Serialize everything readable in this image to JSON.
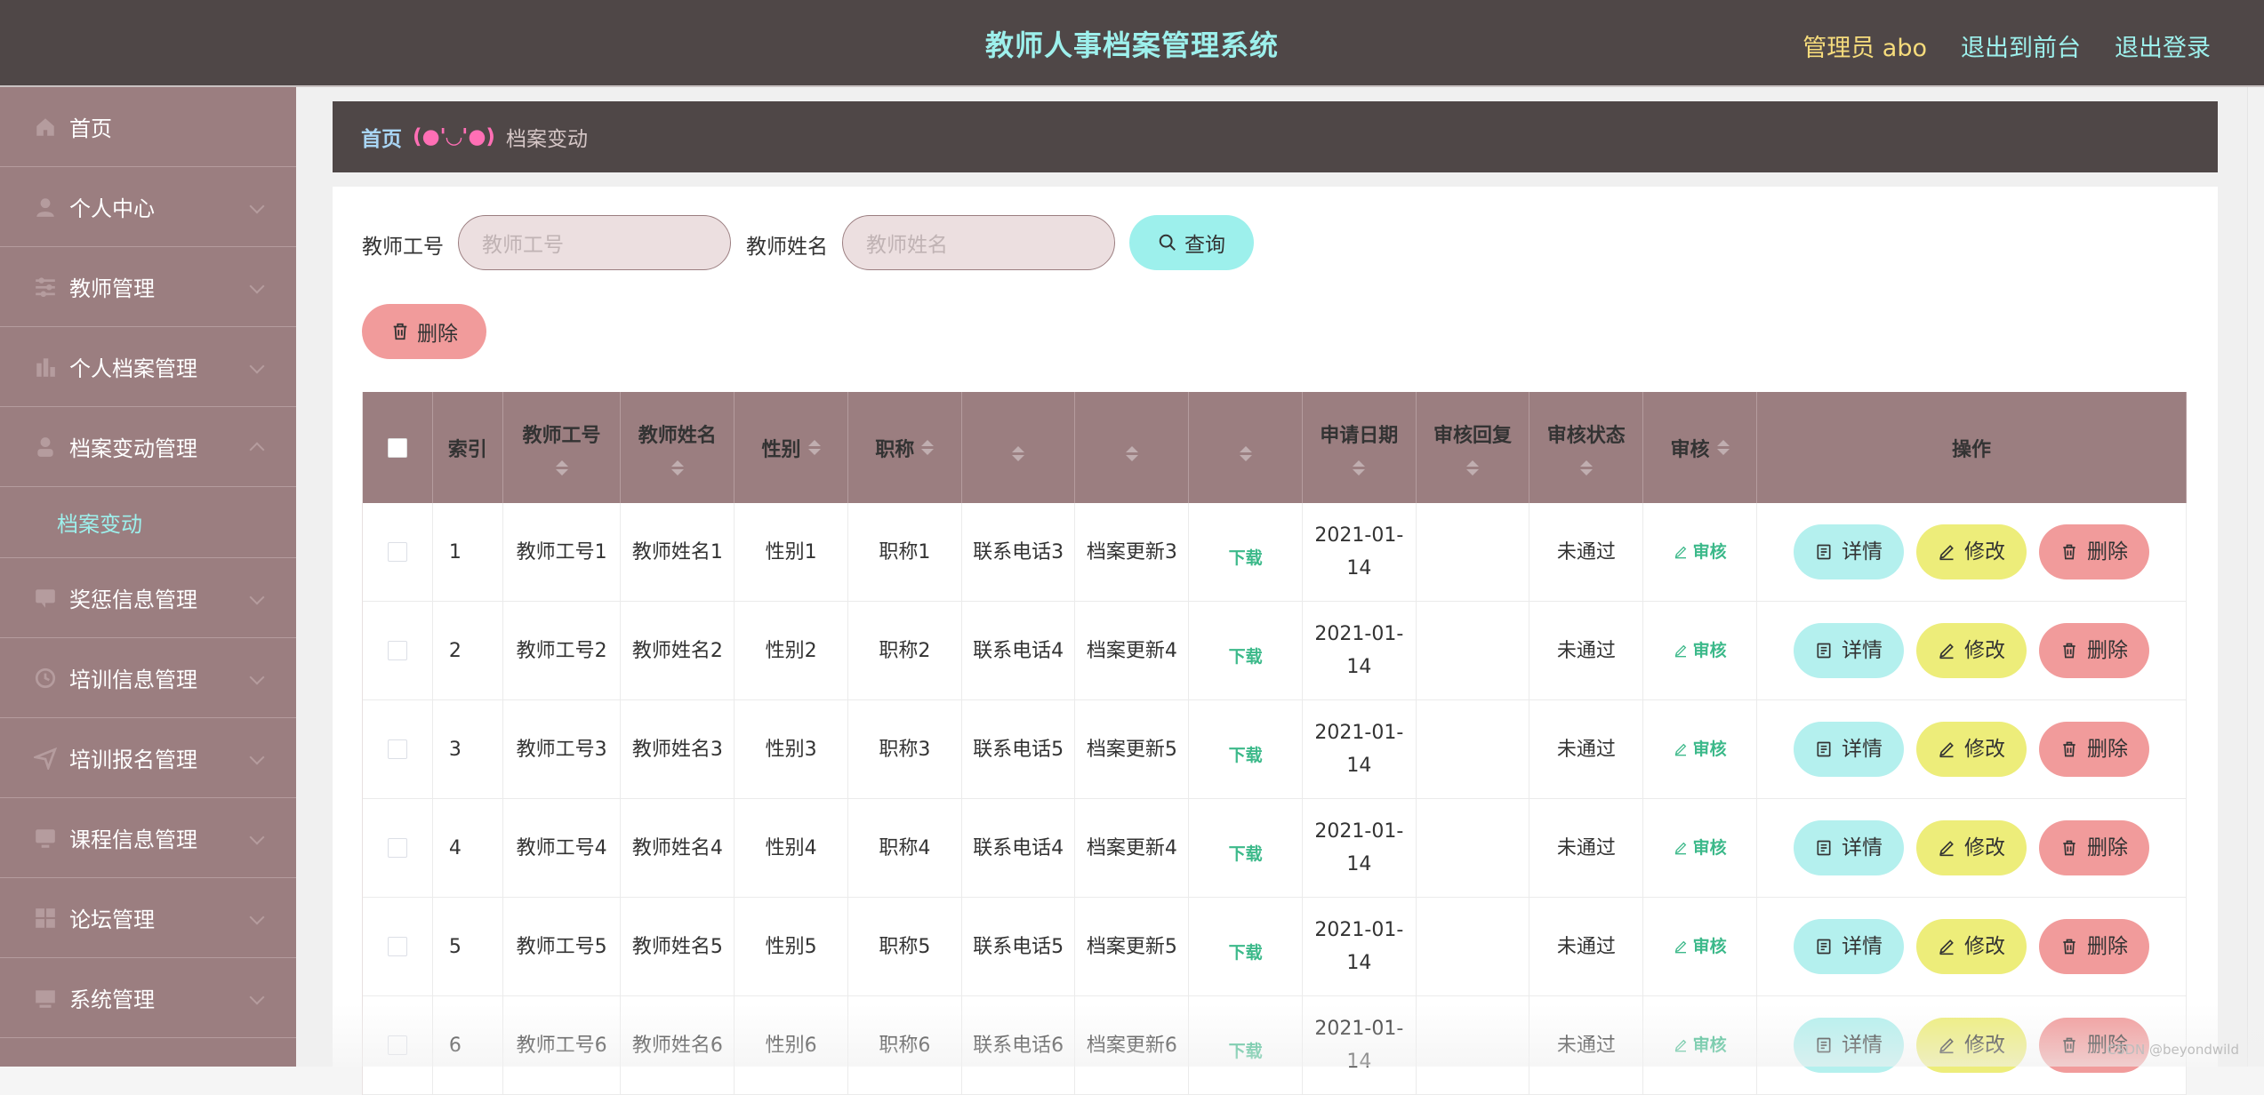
{
  "header": {
    "title": "教师人事档案管理系统",
    "user": "管理员 abo",
    "to_front": "退出到前台",
    "logout": "退出登录"
  },
  "sidebar": {
    "items": [
      {
        "label": "首页",
        "icon": "home-icon"
      },
      {
        "label": "个人中心",
        "icon": "user-icon"
      },
      {
        "label": "教师管理",
        "icon": "sliders-icon"
      },
      {
        "label": "个人档案管理",
        "icon": "bar-chart-icon"
      },
      {
        "label": "档案变动管理",
        "icon": "person-icon",
        "expanded": true
      },
      {
        "label": "奖惩信息管理",
        "icon": "chat-icon"
      },
      {
        "label": "培训信息管理",
        "icon": "clock-icon"
      },
      {
        "label": "培训报名管理",
        "icon": "send-icon"
      },
      {
        "label": "课程信息管理",
        "icon": "monitor-icon"
      },
      {
        "label": "论坛管理",
        "icon": "grid-icon"
      },
      {
        "label": "系统管理",
        "icon": "desktop-icon"
      }
    ],
    "sub_item": "档案变动"
  },
  "breadcrumb": {
    "home": "首页",
    "separator": "(●'◡'●)",
    "current": "档案变动"
  },
  "filters": {
    "teacher_no_label": "教师工号",
    "teacher_no_placeholder": "教师工号",
    "teacher_name_label": "教师姓名",
    "teacher_name_placeholder": "教师姓名",
    "search_button": "查询",
    "batch_delete_button": "删除"
  },
  "table": {
    "columns": [
      "",
      "索引",
      "教师工号",
      "教师姓名",
      "性别",
      "职称",
      "",
      "",
      "",
      "申请日期",
      "审核回复",
      "审核状态",
      "审核",
      "操作"
    ],
    "rows": [
      {
        "index": "1",
        "teacher_no": "教师工号1",
        "teacher_name": "教师姓名1",
        "gender": "性别1",
        "title": "职称1",
        "phone": "联系电话3",
        "update": "档案更新3",
        "download": "下载",
        "date": "2021-01-14",
        "reply": "",
        "status": "未通过",
        "audit": "审核"
      },
      {
        "index": "2",
        "teacher_no": "教师工号2",
        "teacher_name": "教师姓名2",
        "gender": "性别2",
        "title": "职称2",
        "phone": "联系电话4",
        "update": "档案更新4",
        "download": "下载",
        "date": "2021-01-14",
        "reply": "",
        "status": "未通过",
        "audit": "审核"
      },
      {
        "index": "3",
        "teacher_no": "教师工号3",
        "teacher_name": "教师姓名3",
        "gender": "性别3",
        "title": "职称3",
        "phone": "联系电话5",
        "update": "档案更新5",
        "download": "下载",
        "date": "2021-01-14",
        "reply": "",
        "status": "未通过",
        "audit": "审核"
      },
      {
        "index": "4",
        "teacher_no": "教师工号4",
        "teacher_name": "教师姓名4",
        "gender": "性别4",
        "title": "职称4",
        "phone": "联系电话4",
        "update": "档案更新4",
        "download": "下载",
        "date": "2021-01-14",
        "reply": "",
        "status": "未通过",
        "audit": "审核"
      },
      {
        "index": "5",
        "teacher_no": "教师工号5",
        "teacher_name": "教师姓名5",
        "gender": "性别5",
        "title": "职称5",
        "phone": "联系电话5",
        "update": "档案更新5",
        "download": "下载",
        "date": "2021-01-14",
        "reply": "",
        "status": "未通过",
        "audit": "审核"
      },
      {
        "index": "6",
        "teacher_no": "教师工号6",
        "teacher_name": "教师姓名6",
        "gender": "性别6",
        "title": "职称6",
        "phone": "联系电话6",
        "update": "档案更新6",
        "download": "下载",
        "date": "2021-01-14",
        "reply": "",
        "status": "未通过",
        "audit": "审核"
      }
    ],
    "actions": {
      "detail": "详情",
      "edit": "修改",
      "delete": "删除"
    }
  },
  "watermark": "CSDN @beyondwild",
  "colors": {
    "topbar": "#4f4747",
    "sidebar": "#9b7e80",
    "accent_cyan": "#9df0ec",
    "accent_yellow": "#eded7a",
    "accent_red": "#f19b9b",
    "link_green": "#3cb98a"
  }
}
